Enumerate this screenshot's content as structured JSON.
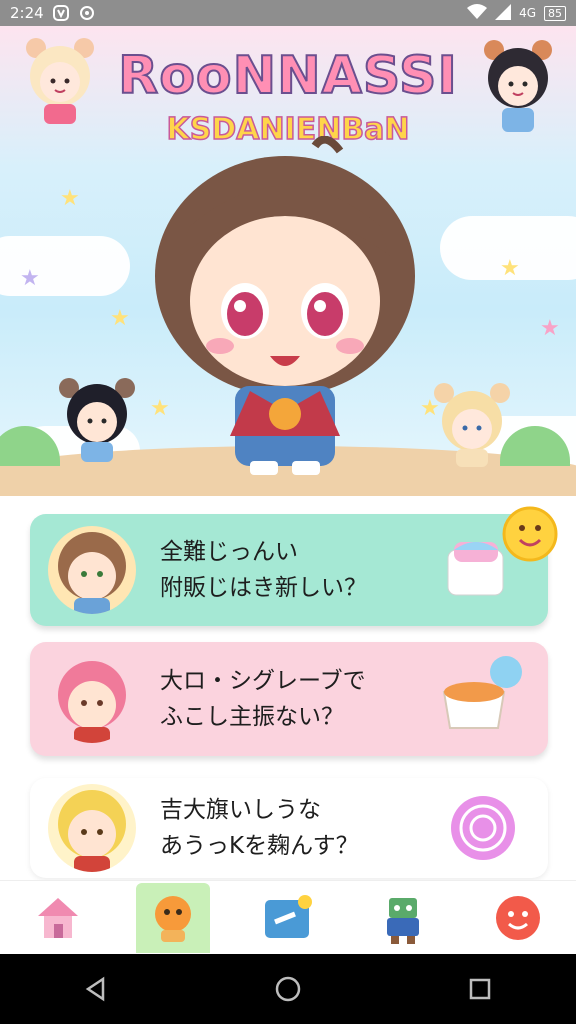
{
  "status_bar": {
    "time": "2:24",
    "signal_label": "4G",
    "battery_label": "85"
  },
  "hero": {
    "title": "RooNNASSI",
    "subtitle": "KSDANIENBaN"
  },
  "questions": [
    {
      "text_line1": "全難じっんい",
      "text_line2": "附販じはき新しい？",
      "bg": "#a5e8d4"
    },
    {
      "text_line1": "大ロ・シグレーブで",
      "text_line2": "ふこし主振ない？",
      "bg": "#fbd3de"
    },
    {
      "text_line1": "吉大旗いしうな",
      "text_line2": "あうっKを麹んす？",
      "bg": "#ffffff"
    }
  ],
  "icons": {
    "status": [
      "notification-icon",
      "settings-icon",
      "wifi-icon",
      "signal-icon",
      "battery-icon"
    ],
    "nav": [
      "home-icon",
      "character-icon",
      "note-icon",
      "robot-icon",
      "face-icon"
    ],
    "system": [
      "back-icon",
      "home-circle-icon",
      "recents-icon"
    ]
  },
  "colors": {
    "status_bar": "#8e8e8e",
    "card_mint": "#a5e8d4",
    "card_pink": "#fbd3de",
    "nav_active": "#c9f0b8"
  }
}
